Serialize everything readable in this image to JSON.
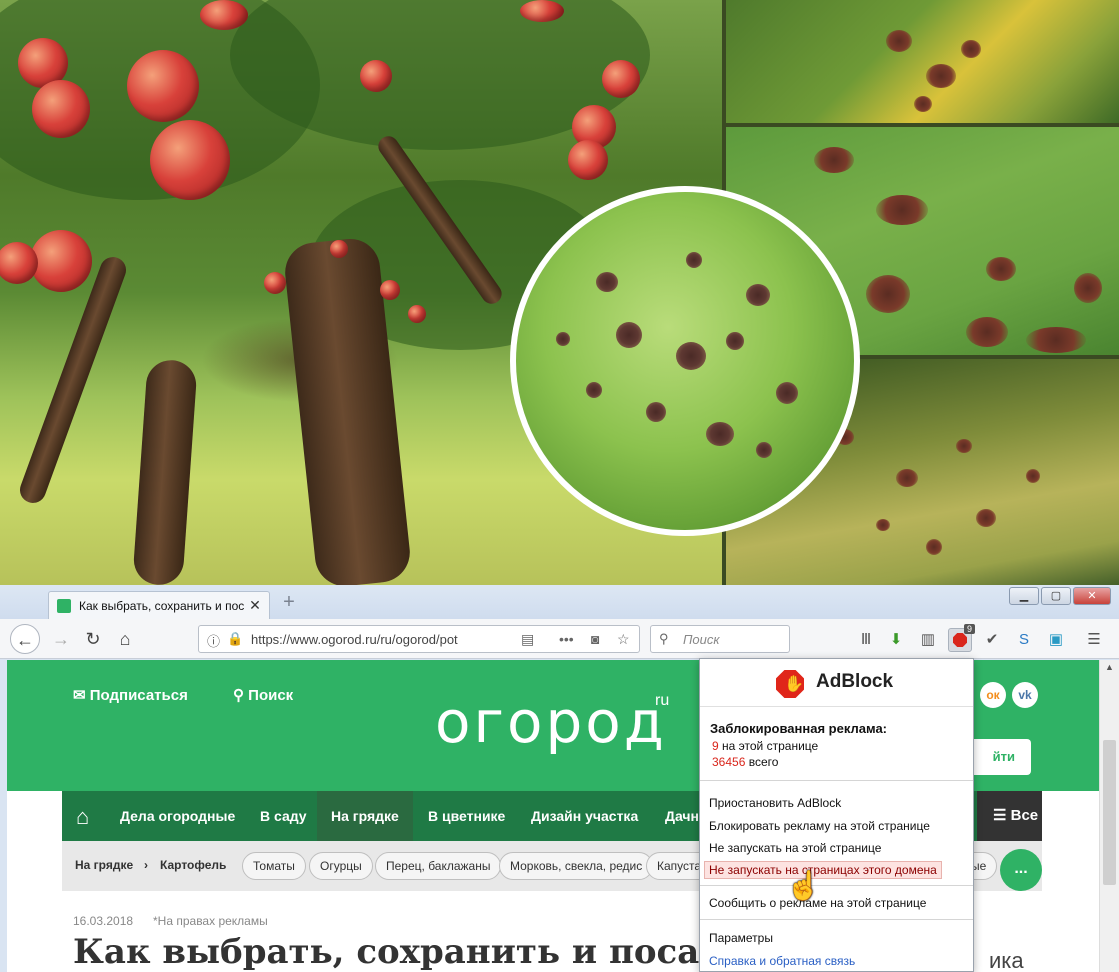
{
  "browser": {
    "tab_title": "Как выбрать, сохранить и пос",
    "tab_close": "✕",
    "new_tab": "+",
    "url": "https://www.ogorod.ru/ru/ogorod/pot",
    "search_placeholder": "Поиск",
    "adblock_badge": "9",
    "window_buttons": {
      "minimize": "▁",
      "maximize": "▢",
      "close": "✕"
    }
  },
  "site": {
    "subscribe": "Подписаться",
    "search": "Поиск",
    "logo": "огород",
    "logo_suffix": "ru",
    "login": "йти",
    "social": [
      "ок",
      "vk"
    ],
    "menu": [
      "Дела огородные",
      "В саду",
      "На грядке",
      "В цветнике",
      "Дизайн участка",
      "Дачн"
    ],
    "menu_all": "Все",
    "breadcrumb": [
      "На грядке",
      "Картофель"
    ],
    "chips": [
      "Томаты",
      "Огурцы",
      "Перец, баклажаны",
      "Морковь, свекла, редис",
      "Капуста,",
      "ые"
    ],
    "more": "...",
    "date": "16.03.2018",
    "ad_note": "*На правах рекламы",
    "headline": "Как выбрать, сохранить и посадить",
    "side_word": "ика"
  },
  "adblock": {
    "brand": "AdBlock",
    "blocked_title": "Заблокированная реклама:",
    "page_count": "9",
    "page_label": "на этой странице",
    "total_count": "36456",
    "total_label": "всего",
    "menu": [
      "Приостановить AdBlock",
      "Блокировать рекламу на этой странице",
      "Не запускать на этой странице",
      "Не запускать на страницах этого домена",
      "Сообщить о рекламе на этой странице",
      "Параметры",
      "Справка и обратная связь"
    ]
  },
  "colors": {
    "brand_green": "#2fb265",
    "menu_green": "#1f7a45",
    "adblock_red": "#d9261c",
    "link_blue": "#2a5fc4"
  },
  "icons": [
    "back-icon",
    "forward-icon",
    "reload-icon",
    "home-icon",
    "info-icon",
    "lock-icon",
    "reader-icon",
    "more-icon",
    "pocket-icon",
    "bookmark-star-icon",
    "search-icon",
    "library-icon",
    "download-icon",
    "sidebar-icon",
    "adblock-icon",
    "check-icon",
    "s-icon",
    "save-icon",
    "hamburger-icon",
    "mail-icon",
    "cursor-hand-icon"
  ]
}
